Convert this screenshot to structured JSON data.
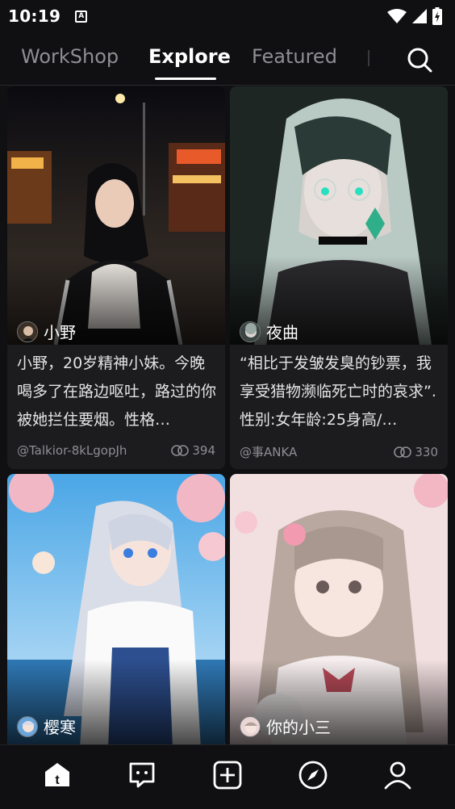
{
  "status": {
    "time": "10:19",
    "notification_badge": "A"
  },
  "tabs": [
    {
      "label": "WorkShop",
      "active": false
    },
    {
      "label": "Explore",
      "active": true
    },
    {
      "label": "Featured",
      "active": false
    }
  ],
  "cards": [
    {
      "name": "小野",
      "description": "小野，20岁精神小妹。今晚喝多了在路边呕吐，路过的你被她拦住要烟。性格…",
      "author": "@Talkior-8kLgopJh",
      "chat_count": "394"
    },
    {
      "name": "夜曲",
      "description": "“相比于发皱发臭的钞票，我享受猎物濒临死亡时的哀求”.性别:女年龄:25身高/…",
      "author": "@事ANKA",
      "chat_count": "330"
    },
    {
      "name": "樱寒"
    },
    {
      "name": "你的小三"
    }
  ],
  "icons": {
    "search": "search-icon",
    "nav": [
      "home-icon",
      "chat-icon",
      "create-icon",
      "discover-icon",
      "profile-icon"
    ]
  },
  "colors": {
    "background": "#101012",
    "card": "#1c1c1f",
    "muted": "#8e8e93"
  }
}
